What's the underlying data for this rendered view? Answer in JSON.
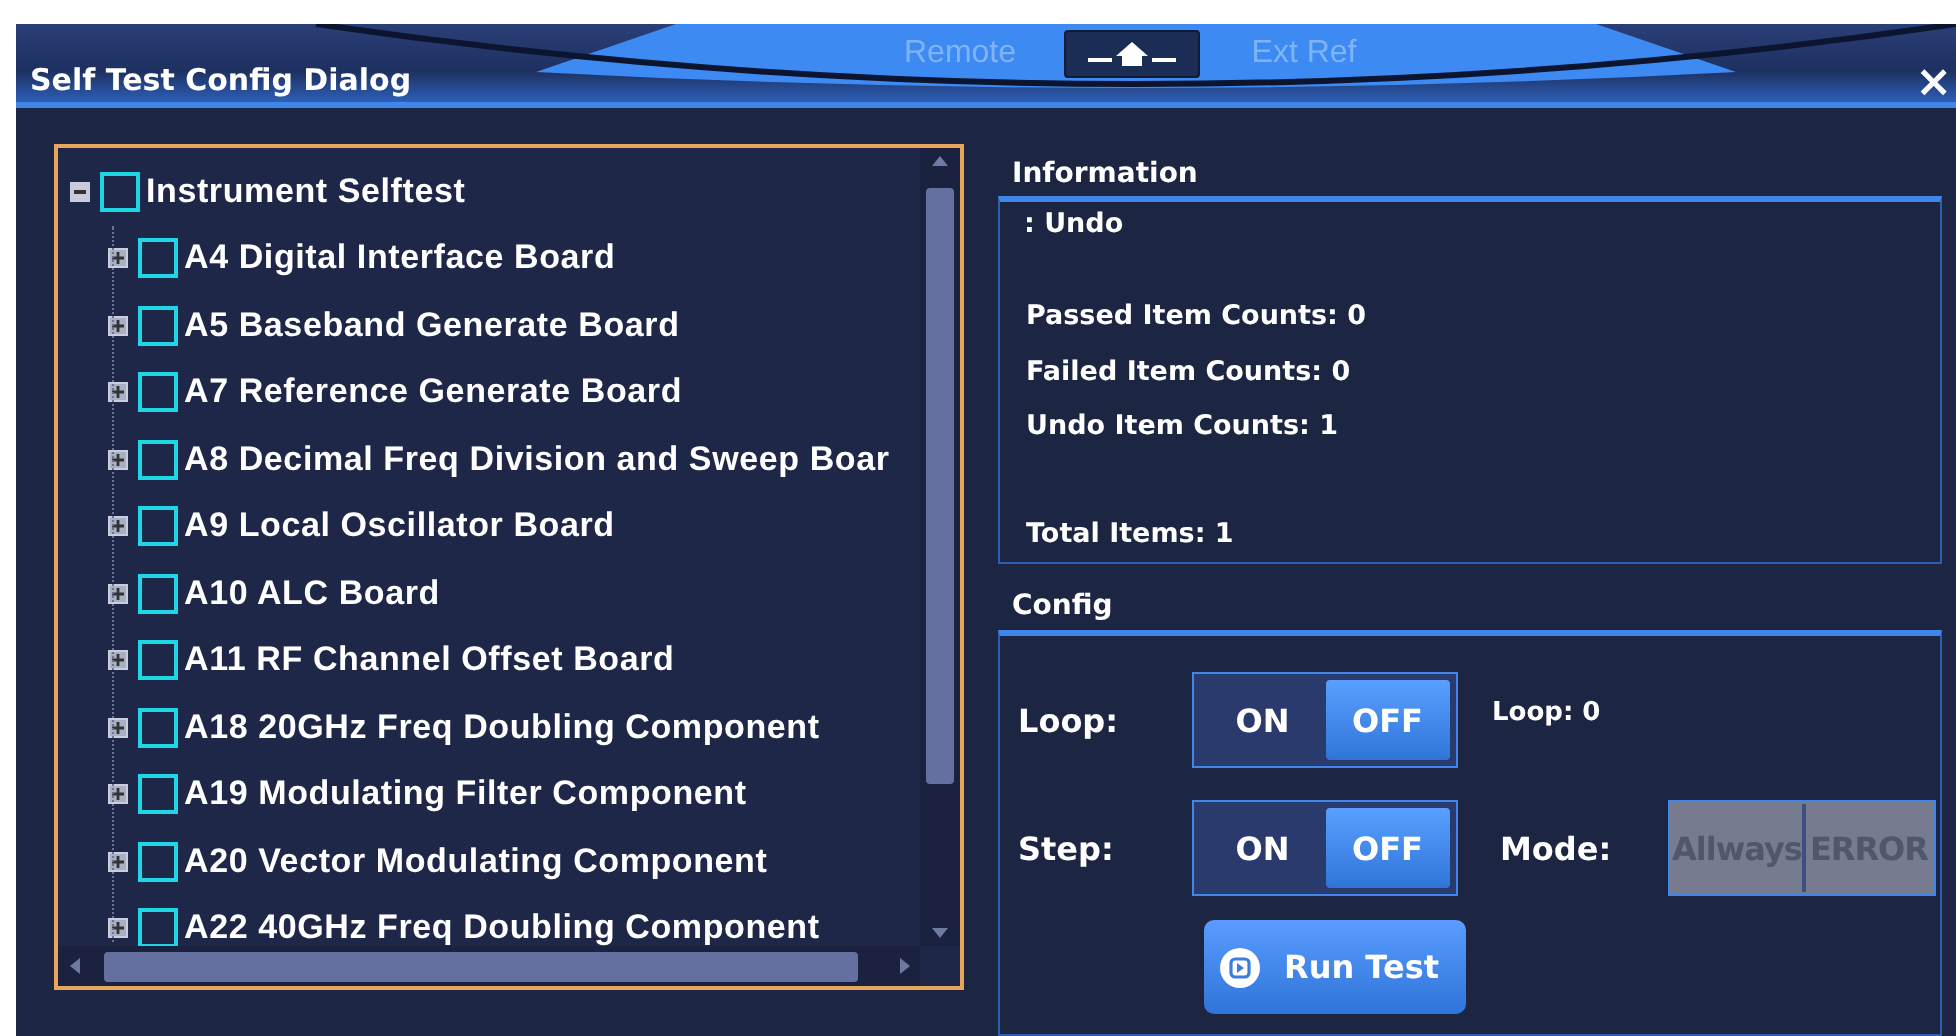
{
  "header": {
    "title": "Self Test Config Dialog",
    "close": "×",
    "indicators": [
      {
        "label": "Remote",
        "lit": false
      },
      {
        "label": "Ext Ref",
        "lit": false
      }
    ]
  },
  "tree": {
    "label": "Instrument Selftest",
    "expanded": true,
    "checked": false,
    "children": [
      {
        "label": "A4 Digital Interface Board",
        "expanded": false,
        "checked": false
      },
      {
        "label": "A5 Baseband Generate Board",
        "expanded": false,
        "checked": false
      },
      {
        "label": "A7 Reference Generate Board",
        "expanded": false,
        "checked": false
      },
      {
        "label": "A8 Decimal Freq Division and Sweep Boar",
        "expanded": false,
        "checked": false
      },
      {
        "label": "A9 Local Oscillator Board",
        "expanded": false,
        "checked": false
      },
      {
        "label": "A10 ALC Board",
        "expanded": false,
        "checked": false
      },
      {
        "label": "A11 RF Channel Offset Board",
        "expanded": false,
        "checked": false
      },
      {
        "label": "A18 20GHz Freq Doubling Component",
        "expanded": false,
        "checked": false
      },
      {
        "label": "A19 Modulating Filter Component",
        "expanded": false,
        "checked": false
      },
      {
        "label": "A20 Vector Modulating Component",
        "expanded": false,
        "checked": false
      },
      {
        "label": "A22 40GHz Freq Doubling Component",
        "expanded": false,
        "checked": false
      }
    ]
  },
  "information": {
    "title": "Information",
    "status": ": Undo",
    "counts": [
      "Passed Item Counts: 0",
      "Failed Item Counts: 0",
      "Undo Item Counts: 1"
    ],
    "total": "Total Items: 1"
  },
  "config": {
    "title": "Config",
    "loop": {
      "label": "Loop:",
      "options": [
        {
          "label": "ON",
          "selected": false
        },
        {
          "label": "OFF",
          "selected": true
        }
      ],
      "reading": "Loop: 0"
    },
    "step": {
      "label": "Step:",
      "options": [
        {
          "label": "ON",
          "selected": false
        },
        {
          "label": "OFF",
          "selected": true
        }
      ]
    },
    "mode": {
      "label": "Mode:",
      "disabled": true,
      "options": [
        {
          "label": "Allways",
          "selected": false
        },
        {
          "label": "ERROR",
          "selected": false
        }
      ]
    },
    "run_button": {
      "label": "Run Test"
    }
  }
}
